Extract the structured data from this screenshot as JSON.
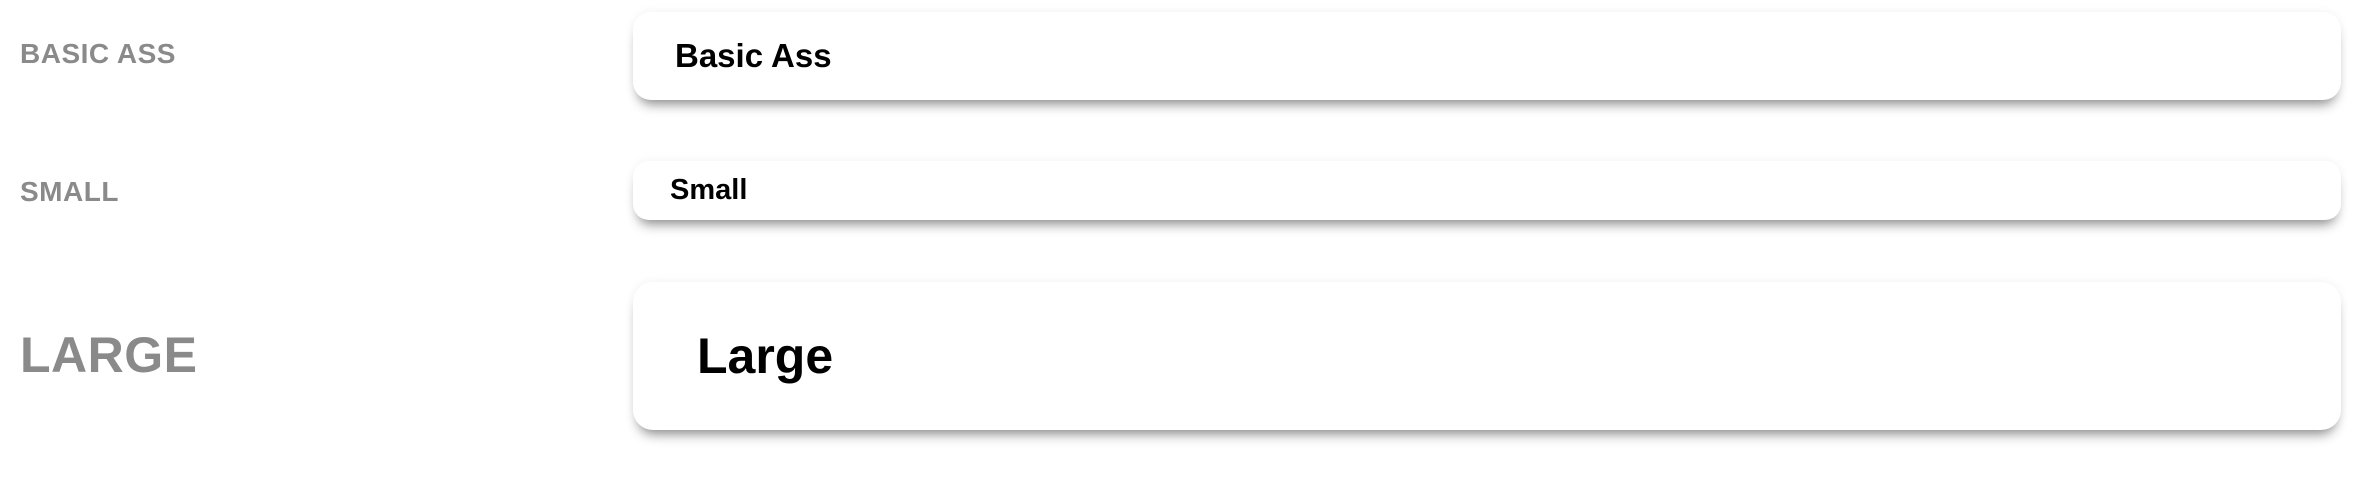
{
  "rows": {
    "basic": {
      "label": "BASIC ASS",
      "value": "Basic Ass"
    },
    "small": {
      "label": "SMALL",
      "value": "Small"
    },
    "large": {
      "label": "LARGE",
      "value": "Large"
    }
  },
  "colors": {
    "label_text": "#8a8a8a",
    "field_text": "#000000",
    "field_background": "#ffffff"
  }
}
